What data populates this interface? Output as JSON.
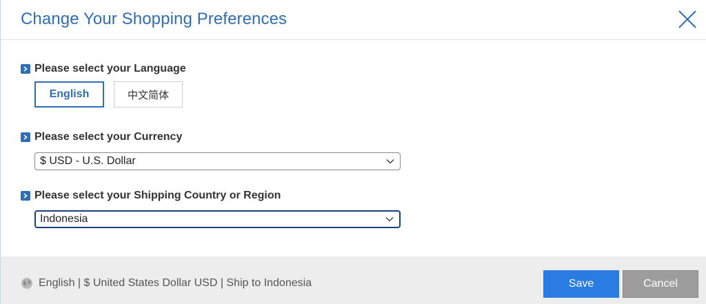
{
  "dialog": {
    "title": "Change Your Shopping Preferences"
  },
  "icons": {
    "close": "close-icon",
    "bullet": "chevron-right-icon",
    "dropdown": "chevron-down-icon",
    "globe": "globe-icon"
  },
  "language": {
    "label": "Please select your Language",
    "options": [
      "English",
      "中文简体"
    ],
    "selected": "English"
  },
  "currency": {
    "label": "Please select your Currency",
    "value": "$ USD - U.S. Dollar"
  },
  "shipping": {
    "label": "Please select your Shipping Country or Region",
    "value": "Indonesia"
  },
  "footer": {
    "summary": "English | $ United States Dollar USD | Ship to Indonesia",
    "save_label": "Save",
    "cancel_label": "Cancel"
  },
  "colors": {
    "accent": "#2f6db5",
    "save": "#2a7be2",
    "cancel": "#9d9d9d",
    "footer_bg": "#ededed"
  }
}
